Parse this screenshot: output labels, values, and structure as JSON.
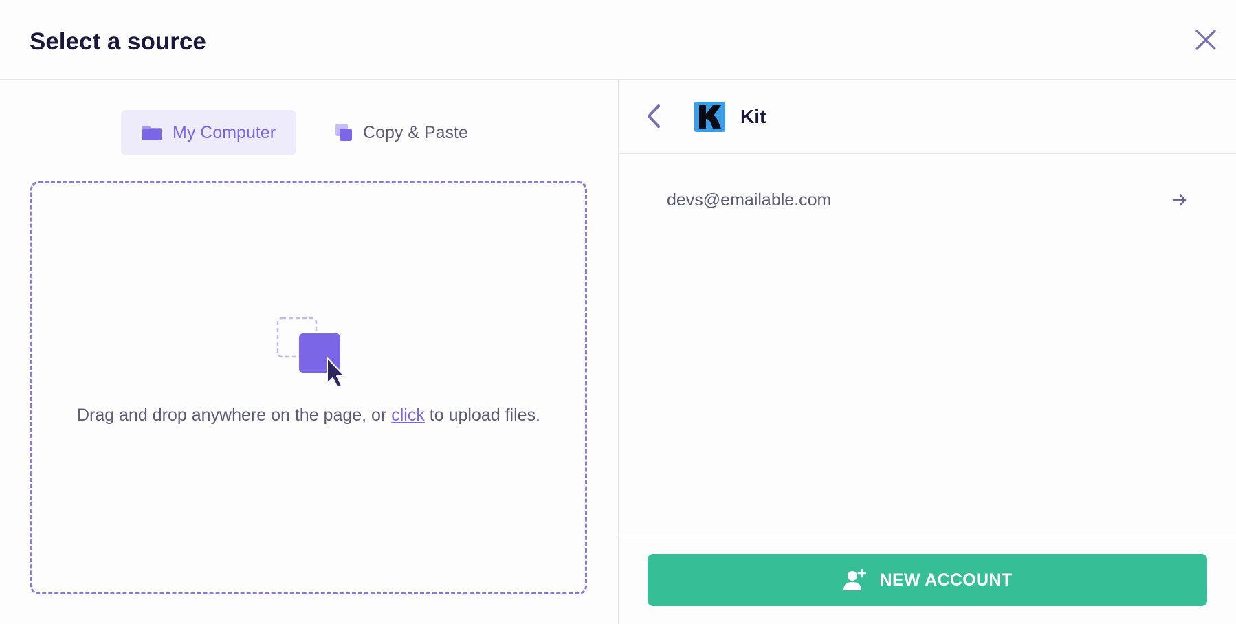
{
  "header": {
    "title": "Select a source"
  },
  "tabs": [
    {
      "label": "My Computer",
      "icon": "folder-icon",
      "active": true
    },
    {
      "label": "Copy & Paste",
      "icon": "copy-icon",
      "active": false
    }
  ],
  "dropzone": {
    "text_before": "Drag and drop anywhere on the page, or ",
    "link_label": "click",
    "text_after": " to upload files."
  },
  "source": {
    "name": "Kit",
    "logo_icon": "kit-logo-icon",
    "accounts": [
      {
        "email": "devs@emailable.com"
      }
    ]
  },
  "footer": {
    "new_account_label": "NEW ACCOUNT"
  },
  "colors": {
    "accent": "#7b66e8",
    "success": "#36bf96",
    "text_dark": "#1b1840",
    "text_muted": "#5c5a78"
  }
}
